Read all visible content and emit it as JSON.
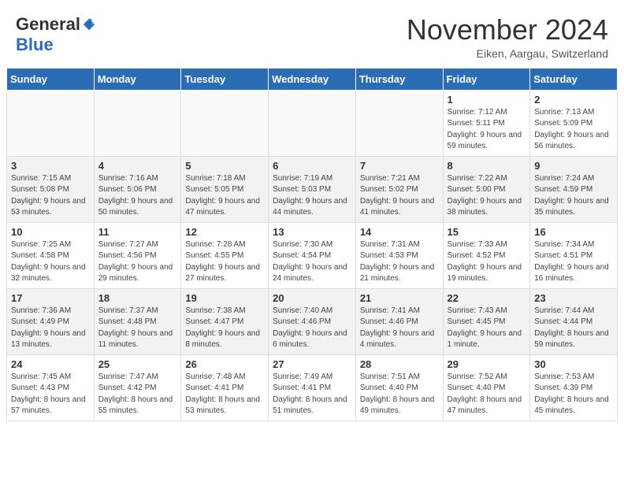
{
  "header": {
    "logo_general": "General",
    "logo_blue": "Blue",
    "month_title": "November 2024",
    "location": "Eiken, Aargau, Switzerland"
  },
  "days_of_week": [
    "Sunday",
    "Monday",
    "Tuesday",
    "Wednesday",
    "Thursday",
    "Friday",
    "Saturday"
  ],
  "weeks": [
    [
      {
        "day": "",
        "info": ""
      },
      {
        "day": "",
        "info": ""
      },
      {
        "day": "",
        "info": ""
      },
      {
        "day": "",
        "info": ""
      },
      {
        "day": "",
        "info": ""
      },
      {
        "day": "1",
        "info": "Sunrise: 7:12 AM\nSunset: 5:11 PM\nDaylight: 9 hours and 59 minutes."
      },
      {
        "day": "2",
        "info": "Sunrise: 7:13 AM\nSunset: 5:09 PM\nDaylight: 9 hours and 56 minutes."
      }
    ],
    [
      {
        "day": "3",
        "info": "Sunrise: 7:15 AM\nSunset: 5:08 PM\nDaylight: 9 hours and 53 minutes."
      },
      {
        "day": "4",
        "info": "Sunrise: 7:16 AM\nSunset: 5:06 PM\nDaylight: 9 hours and 50 minutes."
      },
      {
        "day": "5",
        "info": "Sunrise: 7:18 AM\nSunset: 5:05 PM\nDaylight: 9 hours and 47 minutes."
      },
      {
        "day": "6",
        "info": "Sunrise: 7:19 AM\nSunset: 5:03 PM\nDaylight: 9 hours and 44 minutes."
      },
      {
        "day": "7",
        "info": "Sunrise: 7:21 AM\nSunset: 5:02 PM\nDaylight: 9 hours and 41 minutes."
      },
      {
        "day": "8",
        "info": "Sunrise: 7:22 AM\nSunset: 5:00 PM\nDaylight: 9 hours and 38 minutes."
      },
      {
        "day": "9",
        "info": "Sunrise: 7:24 AM\nSunset: 4:59 PM\nDaylight: 9 hours and 35 minutes."
      }
    ],
    [
      {
        "day": "10",
        "info": "Sunrise: 7:25 AM\nSunset: 4:58 PM\nDaylight: 9 hours and 32 minutes."
      },
      {
        "day": "11",
        "info": "Sunrise: 7:27 AM\nSunset: 4:56 PM\nDaylight: 9 hours and 29 minutes."
      },
      {
        "day": "12",
        "info": "Sunrise: 7:28 AM\nSunset: 4:55 PM\nDaylight: 9 hours and 27 minutes."
      },
      {
        "day": "13",
        "info": "Sunrise: 7:30 AM\nSunset: 4:54 PM\nDaylight: 9 hours and 24 minutes."
      },
      {
        "day": "14",
        "info": "Sunrise: 7:31 AM\nSunset: 4:53 PM\nDaylight: 9 hours and 21 minutes."
      },
      {
        "day": "15",
        "info": "Sunrise: 7:33 AM\nSunset: 4:52 PM\nDaylight: 9 hours and 19 minutes."
      },
      {
        "day": "16",
        "info": "Sunrise: 7:34 AM\nSunset: 4:51 PM\nDaylight: 9 hours and 16 minutes."
      }
    ],
    [
      {
        "day": "17",
        "info": "Sunrise: 7:36 AM\nSunset: 4:49 PM\nDaylight: 9 hours and 13 minutes."
      },
      {
        "day": "18",
        "info": "Sunrise: 7:37 AM\nSunset: 4:48 PM\nDaylight: 9 hours and 11 minutes."
      },
      {
        "day": "19",
        "info": "Sunrise: 7:38 AM\nSunset: 4:47 PM\nDaylight: 9 hours and 8 minutes."
      },
      {
        "day": "20",
        "info": "Sunrise: 7:40 AM\nSunset: 4:46 PM\nDaylight: 9 hours and 6 minutes."
      },
      {
        "day": "21",
        "info": "Sunrise: 7:41 AM\nSunset: 4:46 PM\nDaylight: 9 hours and 4 minutes."
      },
      {
        "day": "22",
        "info": "Sunrise: 7:43 AM\nSunset: 4:45 PM\nDaylight: 9 hours and 1 minute."
      },
      {
        "day": "23",
        "info": "Sunrise: 7:44 AM\nSunset: 4:44 PM\nDaylight: 8 hours and 59 minutes."
      }
    ],
    [
      {
        "day": "24",
        "info": "Sunrise: 7:45 AM\nSunset: 4:43 PM\nDaylight: 8 hours and 57 minutes."
      },
      {
        "day": "25",
        "info": "Sunrise: 7:47 AM\nSunset: 4:42 PM\nDaylight: 8 hours and 55 minutes."
      },
      {
        "day": "26",
        "info": "Sunrise: 7:48 AM\nSunset: 4:41 PM\nDaylight: 8 hours and 53 minutes."
      },
      {
        "day": "27",
        "info": "Sunrise: 7:49 AM\nSunset: 4:41 PM\nDaylight: 8 hours and 51 minutes."
      },
      {
        "day": "28",
        "info": "Sunrise: 7:51 AM\nSunset: 4:40 PM\nDaylight: 8 hours and 49 minutes."
      },
      {
        "day": "29",
        "info": "Sunrise: 7:52 AM\nSunset: 4:40 PM\nDaylight: 8 hours and 47 minutes."
      },
      {
        "day": "30",
        "info": "Sunrise: 7:53 AM\nSunset: 4:39 PM\nDaylight: 8 hours and 45 minutes."
      }
    ]
  ]
}
